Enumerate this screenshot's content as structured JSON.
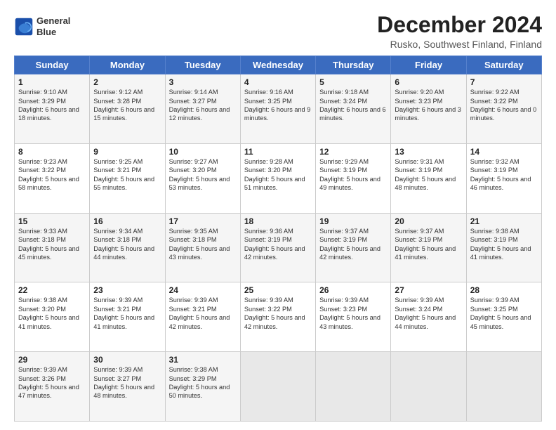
{
  "logo": {
    "line1": "General",
    "line2": "Blue"
  },
  "title": "December 2024",
  "subtitle": "Rusko, Southwest Finland, Finland",
  "header": {
    "days": [
      "Sunday",
      "Monday",
      "Tuesday",
      "Wednesday",
      "Thursday",
      "Friday",
      "Saturday"
    ]
  },
  "weeks": [
    [
      {
        "day": "1",
        "sunrise": "9:10 AM",
        "sunset": "3:29 PM",
        "daylight": "6 hours and 18 minutes."
      },
      {
        "day": "2",
        "sunrise": "9:12 AM",
        "sunset": "3:28 PM",
        "daylight": "6 hours and 15 minutes."
      },
      {
        "day": "3",
        "sunrise": "9:14 AM",
        "sunset": "3:27 PM",
        "daylight": "6 hours and 12 minutes."
      },
      {
        "day": "4",
        "sunrise": "9:16 AM",
        "sunset": "3:25 PM",
        "daylight": "6 hours and 9 minutes."
      },
      {
        "day": "5",
        "sunrise": "9:18 AM",
        "sunset": "3:24 PM",
        "daylight": "6 hours and 6 minutes."
      },
      {
        "day": "6",
        "sunrise": "9:20 AM",
        "sunset": "3:23 PM",
        "daylight": "6 hours and 3 minutes."
      },
      {
        "day": "7",
        "sunrise": "9:22 AM",
        "sunset": "3:22 PM",
        "daylight": "6 hours and 0 minutes."
      }
    ],
    [
      {
        "day": "8",
        "sunrise": "9:23 AM",
        "sunset": "3:22 PM",
        "daylight": "5 hours and 58 minutes."
      },
      {
        "day": "9",
        "sunrise": "9:25 AM",
        "sunset": "3:21 PM",
        "daylight": "5 hours and 55 minutes."
      },
      {
        "day": "10",
        "sunrise": "9:27 AM",
        "sunset": "3:20 PM",
        "daylight": "5 hours and 53 minutes."
      },
      {
        "day": "11",
        "sunrise": "9:28 AM",
        "sunset": "3:20 PM",
        "daylight": "5 hours and 51 minutes."
      },
      {
        "day": "12",
        "sunrise": "9:29 AM",
        "sunset": "3:19 PM",
        "daylight": "5 hours and 49 minutes."
      },
      {
        "day": "13",
        "sunrise": "9:31 AM",
        "sunset": "3:19 PM",
        "daylight": "5 hours and 48 minutes."
      },
      {
        "day": "14",
        "sunrise": "9:32 AM",
        "sunset": "3:19 PM",
        "daylight": "5 hours and 46 minutes."
      }
    ],
    [
      {
        "day": "15",
        "sunrise": "9:33 AM",
        "sunset": "3:18 PM",
        "daylight": "5 hours and 45 minutes."
      },
      {
        "day": "16",
        "sunrise": "9:34 AM",
        "sunset": "3:18 PM",
        "daylight": "5 hours and 44 minutes."
      },
      {
        "day": "17",
        "sunrise": "9:35 AM",
        "sunset": "3:18 PM",
        "daylight": "5 hours and 43 minutes."
      },
      {
        "day": "18",
        "sunrise": "9:36 AM",
        "sunset": "3:19 PM",
        "daylight": "5 hours and 42 minutes."
      },
      {
        "day": "19",
        "sunrise": "9:37 AM",
        "sunset": "3:19 PM",
        "daylight": "5 hours and 42 minutes."
      },
      {
        "day": "20",
        "sunrise": "9:37 AM",
        "sunset": "3:19 PM",
        "daylight": "5 hours and 41 minutes."
      },
      {
        "day": "21",
        "sunrise": "9:38 AM",
        "sunset": "3:19 PM",
        "daylight": "5 hours and 41 minutes."
      }
    ],
    [
      {
        "day": "22",
        "sunrise": "9:38 AM",
        "sunset": "3:20 PM",
        "daylight": "5 hours and 41 minutes."
      },
      {
        "day": "23",
        "sunrise": "9:39 AM",
        "sunset": "3:21 PM",
        "daylight": "5 hours and 41 minutes."
      },
      {
        "day": "24",
        "sunrise": "9:39 AM",
        "sunset": "3:21 PM",
        "daylight": "5 hours and 42 minutes."
      },
      {
        "day": "25",
        "sunrise": "9:39 AM",
        "sunset": "3:22 PM",
        "daylight": "5 hours and 42 minutes."
      },
      {
        "day": "26",
        "sunrise": "9:39 AM",
        "sunset": "3:23 PM",
        "daylight": "5 hours and 43 minutes."
      },
      {
        "day": "27",
        "sunrise": "9:39 AM",
        "sunset": "3:24 PM",
        "daylight": "5 hours and 44 minutes."
      },
      {
        "day": "28",
        "sunrise": "9:39 AM",
        "sunset": "3:25 PM",
        "daylight": "5 hours and 45 minutes."
      }
    ],
    [
      {
        "day": "29",
        "sunrise": "9:39 AM",
        "sunset": "3:26 PM",
        "daylight": "5 hours and 47 minutes."
      },
      {
        "day": "30",
        "sunrise": "9:39 AM",
        "sunset": "3:27 PM",
        "daylight": "5 hours and 48 minutes."
      },
      {
        "day": "31",
        "sunrise": "9:38 AM",
        "sunset": "3:29 PM",
        "daylight": "5 hours and 50 minutes."
      },
      null,
      null,
      null,
      null
    ]
  ]
}
